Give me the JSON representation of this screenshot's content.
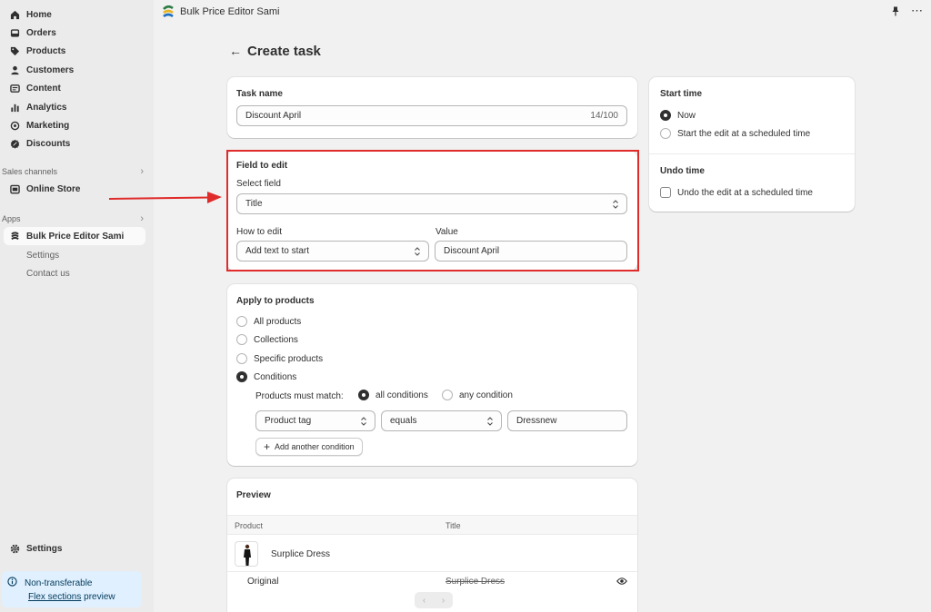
{
  "sidebar": {
    "nav": [
      {
        "label": "Home",
        "icon": "home-icon"
      },
      {
        "label": "Orders",
        "icon": "inbox-icon"
      },
      {
        "label": "Products",
        "icon": "tag-icon"
      },
      {
        "label": "Customers",
        "icon": "person-icon"
      },
      {
        "label": "Content",
        "icon": "content-icon"
      },
      {
        "label": "Analytics",
        "icon": "bar-chart-icon"
      },
      {
        "label": "Marketing",
        "icon": "target-icon"
      },
      {
        "label": "Discounts",
        "icon": "discount-icon"
      }
    ],
    "sales_channels_label": "Sales channels",
    "online_store_label": "Online Store",
    "apps_label": "Apps",
    "app_name": "Bulk Price Editor Sami",
    "app_sub": [
      "Settings",
      "Contact us"
    ],
    "settings_label": "Settings",
    "banner": {
      "line1": "Non-transferable",
      "link": "Flex sections",
      "line2_rest": " preview"
    }
  },
  "topbar": {
    "app_title": "Bulk Price Editor Sami",
    "pin_icon": "pin-icon",
    "more_icon": "more-icon"
  },
  "page": {
    "back_icon": "←",
    "title": "Create task"
  },
  "task_name": {
    "title": "Task name",
    "value": "Discount April",
    "counter": "14/100"
  },
  "field_to_edit": {
    "title": "Field to edit",
    "select_label": "Select field",
    "select_value": "Title",
    "how_label": "How to edit",
    "how_value": "Add text to start",
    "value_label": "Value",
    "value_value": "Discount April"
  },
  "apply": {
    "title": "Apply to products",
    "options": [
      "All products",
      "Collections",
      "Specific products",
      "Conditions"
    ],
    "selected": "Conditions",
    "match_label": "Products must match:",
    "match_all": "all conditions",
    "match_any": "any condition",
    "cond_field": "Product tag",
    "cond_op": "equals",
    "cond_value": "Dressnew",
    "add_condition": "Add another condition"
  },
  "preview": {
    "title": "Preview",
    "col_product": "Product",
    "col_title": "Title",
    "product_name": "Surplice Dress",
    "original_label": "Original",
    "original_value": "Surplice Dress"
  },
  "start_time": {
    "title": "Start time",
    "now": "Now",
    "scheduled": "Start the edit at a scheduled time"
  },
  "undo_time": {
    "title": "Undo time",
    "scheduled": "Undo the edit at a scheduled time"
  },
  "colors": {
    "highlight": "#e02b2b",
    "arrow": "#e02b2b",
    "banner": "#e0f0ff"
  }
}
